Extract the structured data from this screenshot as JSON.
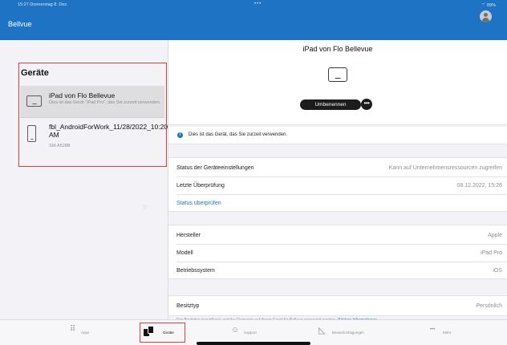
{
  "status_bar": {
    "time": "15:27  Donnerstag 8. Dez.",
    "dots": "•••",
    "battery": "89%"
  },
  "left_header": {
    "title": "Bellvue"
  },
  "device_list": {
    "section_title": "Geräte",
    "items": [
      {
        "name": "iPad von Flo Bellevue",
        "description": "Dies ist das Gerät \"iPad Pro\", das Sie zurzeit verwenden.",
        "icon": "tablet-icon",
        "selected": true
      },
      {
        "name": "fbl_AndroidForWork_11/28/2022_10:20 AM",
        "subtitle": "SM-A528B",
        "icon": "phone-icon",
        "selected": false
      }
    ]
  },
  "detail": {
    "title": "iPad von Flo Bellevue",
    "rename_label": "Umbenennen",
    "more_label": "•••",
    "info_banner": "Dies ist das Gerät, das Sie zurzeit verwenden.",
    "status_rows": [
      {
        "label": "Status der Geräteeinstellungen",
        "value": "Kann auf Unternehmensressourcen zugreifen"
      },
      {
        "label": "Letzte Überprüfung",
        "value": "08.12.2022, 15:26"
      }
    ],
    "check_status_link": "Status überprüfen",
    "hardware_rows": [
      {
        "label": "Hersteller",
        "value": "Apple"
      },
      {
        "label": "Modell",
        "value": "iPad Pro"
      },
      {
        "label": "Betriebssystem",
        "value": "iOS"
      }
    ],
    "ownership_row": {
      "label": "Besitztyp",
      "value": "Persönlich"
    },
    "footnote": "Der Besitztyp beeinflusst, welche Elemente auf Ihrem Gerät für Bellvue angezeigt werden.",
    "footnote_link": "Weitere Informationen"
  },
  "tab_bar": {
    "tabs": [
      {
        "label": "Apps",
        "icon": "apps-grid-icon",
        "glyph": "⠿",
        "active": false
      },
      {
        "label": "Geräte",
        "icon": "devices-icon",
        "glyph": "",
        "active": true
      },
      {
        "label": "Support",
        "icon": "support-icon",
        "glyph": "☺",
        "active": false
      },
      {
        "label": "Benachrichtigungen",
        "icon": "notifications-icon",
        "glyph": "◺",
        "active": false
      },
      {
        "label": "Mehr",
        "icon": "more-icon",
        "glyph": "•••",
        "active": false
      }
    ]
  },
  "colors": {
    "accent": "#1e73c4",
    "highlight_red": "#e0403c",
    "background": "#f2f2f7"
  }
}
